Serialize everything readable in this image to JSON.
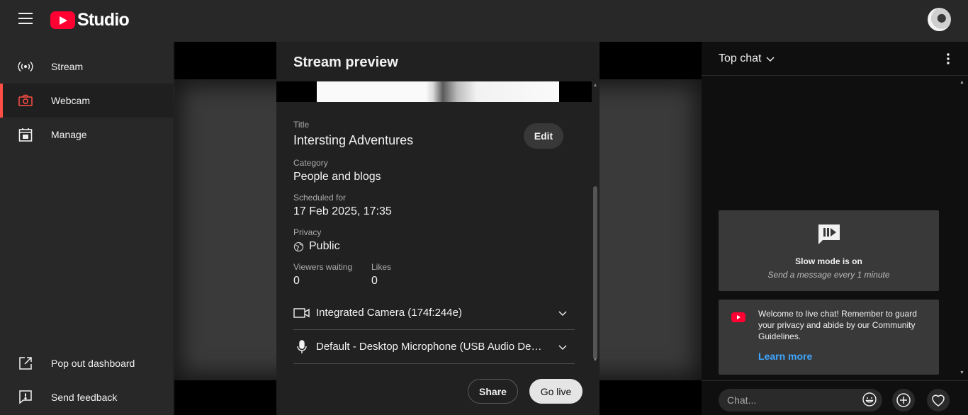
{
  "app": {
    "logo_text": "Studio"
  },
  "sidebar": {
    "items": [
      {
        "label": "Stream",
        "icon": "broadcast-icon"
      },
      {
        "label": "Webcam",
        "icon": "camera-icon",
        "active": true
      },
      {
        "label": "Manage",
        "icon": "calendar-icon"
      }
    ],
    "bottom_items": [
      {
        "label": "Pop out dashboard",
        "icon": "external-link-icon"
      },
      {
        "label": "Send feedback",
        "icon": "feedback-icon"
      }
    ]
  },
  "preview": {
    "title": "Stream preview",
    "edit_label": "Edit",
    "fields": {
      "title_label": "Title",
      "title_value": "Intersting Adventures",
      "category_label": "Category",
      "category_value": "People and blogs",
      "scheduled_label": "Scheduled for",
      "scheduled_value": "17 Feb 2025, 17:35",
      "privacy_label": "Privacy",
      "privacy_value": "Public",
      "viewers_label": "Viewers waiting",
      "viewers_value": "0",
      "likes_label": "Likes",
      "likes_value": "0"
    },
    "camera": "Integrated Camera (174f:244e)",
    "microphone": "Default - Desktop Microphone (USB Audio Device)",
    "share_label": "Share",
    "golive_label": "Go live"
  },
  "chat": {
    "title": "Top chat",
    "slow_mode_title": "Slow mode is on",
    "slow_mode_sub": "Send a message every 1 minute",
    "welcome_text": "Welcome to live chat! Remember to guard your privacy and abide by our Community Guidelines.",
    "learn_more": "Learn more",
    "input_placeholder": "Chat..."
  },
  "colors": {
    "accent_red": "#ff0033",
    "link_blue": "#3ea6ff",
    "active_indicator": "#ff4e45"
  }
}
